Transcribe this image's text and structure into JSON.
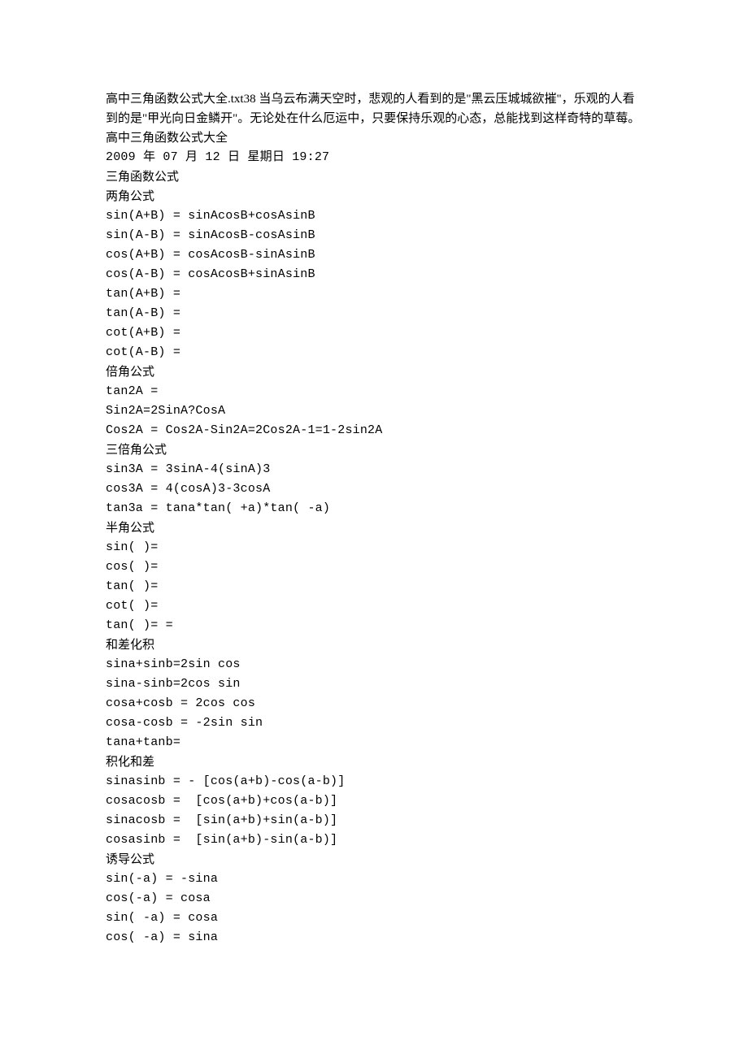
{
  "header": {
    "intro": "高中三角函数公式大全.txt38 当乌云布满天空时，悲观的人看到的是\"黑云压城城欲摧\"，乐观的人看到的是\"甲光向日金鳞开\"。无论处在什么厄运中，只要保持乐观的心态，总能找到这样奇特的草莓。高中三角函数公式大全",
    "date": "2009 年 07 月 12 日 星期日 19:27"
  },
  "sections": [
    {
      "title": "三角函数公式"
    },
    {
      "title": "两角公式"
    },
    {
      "formula": "sin(A+B) = sinAcosB+cosAsinB"
    },
    {
      "formula": "sin(A-B) = sinAcosB-cosAsinB"
    },
    {
      "formula": "cos(A+B) = cosAcosB-sinAsinB"
    },
    {
      "formula": "cos(A-B) = cosAcosB+sinAsinB"
    },
    {
      "formula": "tan(A+B) ="
    },
    {
      "formula": "tan(A-B) ="
    },
    {
      "formula": "cot(A+B) ="
    },
    {
      "formula": "cot(A-B) ="
    },
    {
      "title": "倍角公式"
    },
    {
      "formula": "tan2A ="
    },
    {
      "formula": "Sin2A=2SinA?CosA"
    },
    {
      "formula": "Cos2A = Cos2A-Sin2A=2Cos2A-1=1-2sin2A"
    },
    {
      "title": "三倍角公式"
    },
    {
      "formula": "sin3A = 3sinA-4(sinA)3"
    },
    {
      "formula": "cos3A = 4(cosA)3-3cosA"
    },
    {
      "formula": "tan3a = tana*tan( +a)*tan( -a)"
    },
    {
      "title": "半角公式"
    },
    {
      "formula": "sin( )="
    },
    {
      "formula": "cos( )="
    },
    {
      "formula": "tan( )="
    },
    {
      "formula": "cot( )="
    },
    {
      "formula": "tan( )= ="
    },
    {
      "title": "和差化积"
    },
    {
      "formula": "sina+sinb=2sin cos"
    },
    {
      "formula": "sina-sinb=2cos sin"
    },
    {
      "formula": "cosa+cosb = 2cos cos"
    },
    {
      "formula": "cosa-cosb = -2sin sin"
    },
    {
      "formula": "tana+tanb="
    },
    {
      "title": "积化和差"
    },
    {
      "formula": "sinasinb = - [cos(a+b)-cos(a-b)]"
    },
    {
      "formula": "cosacosb =  [cos(a+b)+cos(a-b)]"
    },
    {
      "formula": "sinacosb =  [sin(a+b)+sin(a-b)]"
    },
    {
      "formula": "cosasinb =  [sin(a+b)-sin(a-b)]"
    },
    {
      "title": "诱导公式"
    },
    {
      "formula": "sin(-a) = -sina"
    },
    {
      "formula": "cos(-a) = cosa"
    },
    {
      "formula": "sin( -a) = cosa"
    },
    {
      "formula": "cos( -a) = sina"
    }
  ]
}
